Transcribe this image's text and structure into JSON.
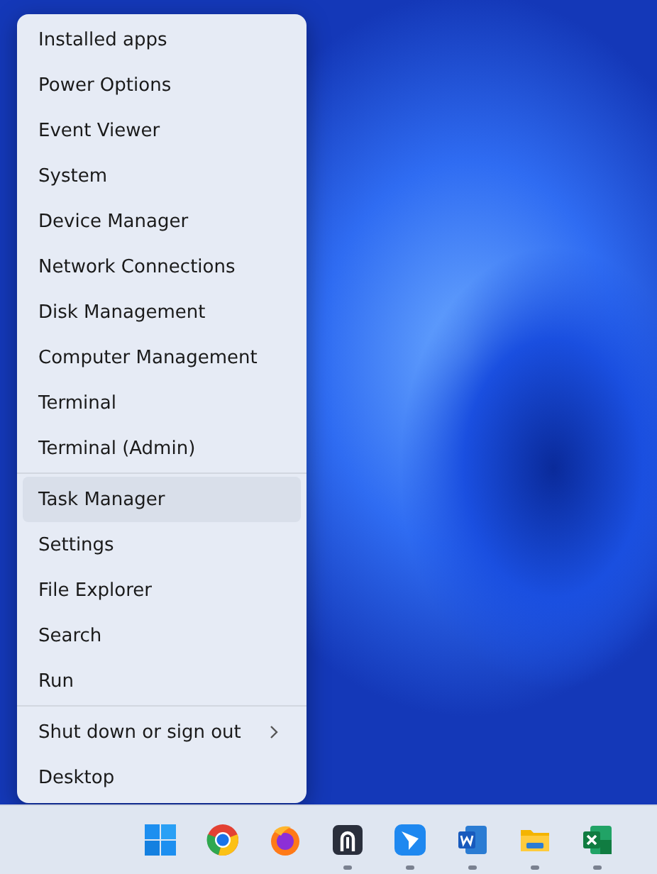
{
  "menu": {
    "groups": [
      {
        "items": [
          {
            "label": "Installed apps",
            "selected": false,
            "submenu": false
          },
          {
            "label": "Power Options",
            "selected": false,
            "submenu": false
          },
          {
            "label": "Event Viewer",
            "selected": false,
            "submenu": false
          },
          {
            "label": "System",
            "selected": false,
            "submenu": false
          },
          {
            "label": "Device Manager",
            "selected": false,
            "submenu": false
          },
          {
            "label": "Network Connections",
            "selected": false,
            "submenu": false
          },
          {
            "label": "Disk Management",
            "selected": false,
            "submenu": false
          },
          {
            "label": "Computer Management",
            "selected": false,
            "submenu": false
          },
          {
            "label": "Terminal",
            "selected": false,
            "submenu": false
          },
          {
            "label": "Terminal (Admin)",
            "selected": false,
            "submenu": false
          }
        ]
      },
      {
        "items": [
          {
            "label": "Task Manager",
            "selected": true,
            "submenu": false
          },
          {
            "label": "Settings",
            "selected": false,
            "submenu": false
          },
          {
            "label": "File Explorer",
            "selected": false,
            "submenu": false
          },
          {
            "label": "Search",
            "selected": false,
            "submenu": false
          },
          {
            "label": "Run",
            "selected": false,
            "submenu": false
          }
        ]
      },
      {
        "items": [
          {
            "label": "Shut down or sign out",
            "selected": false,
            "submenu": true
          },
          {
            "label": "Desktop",
            "selected": false,
            "submenu": false
          }
        ]
      }
    ]
  },
  "taskbar": {
    "apps": [
      {
        "kind": "start",
        "running": false
      },
      {
        "kind": "chrome",
        "running": false
      },
      {
        "kind": "firefox",
        "running": false
      },
      {
        "kind": "terminal",
        "running": true
      },
      {
        "kind": "messenger",
        "running": true
      },
      {
        "kind": "word",
        "running": true
      },
      {
        "kind": "folder",
        "running": true
      },
      {
        "kind": "excel",
        "running": true
      }
    ]
  }
}
